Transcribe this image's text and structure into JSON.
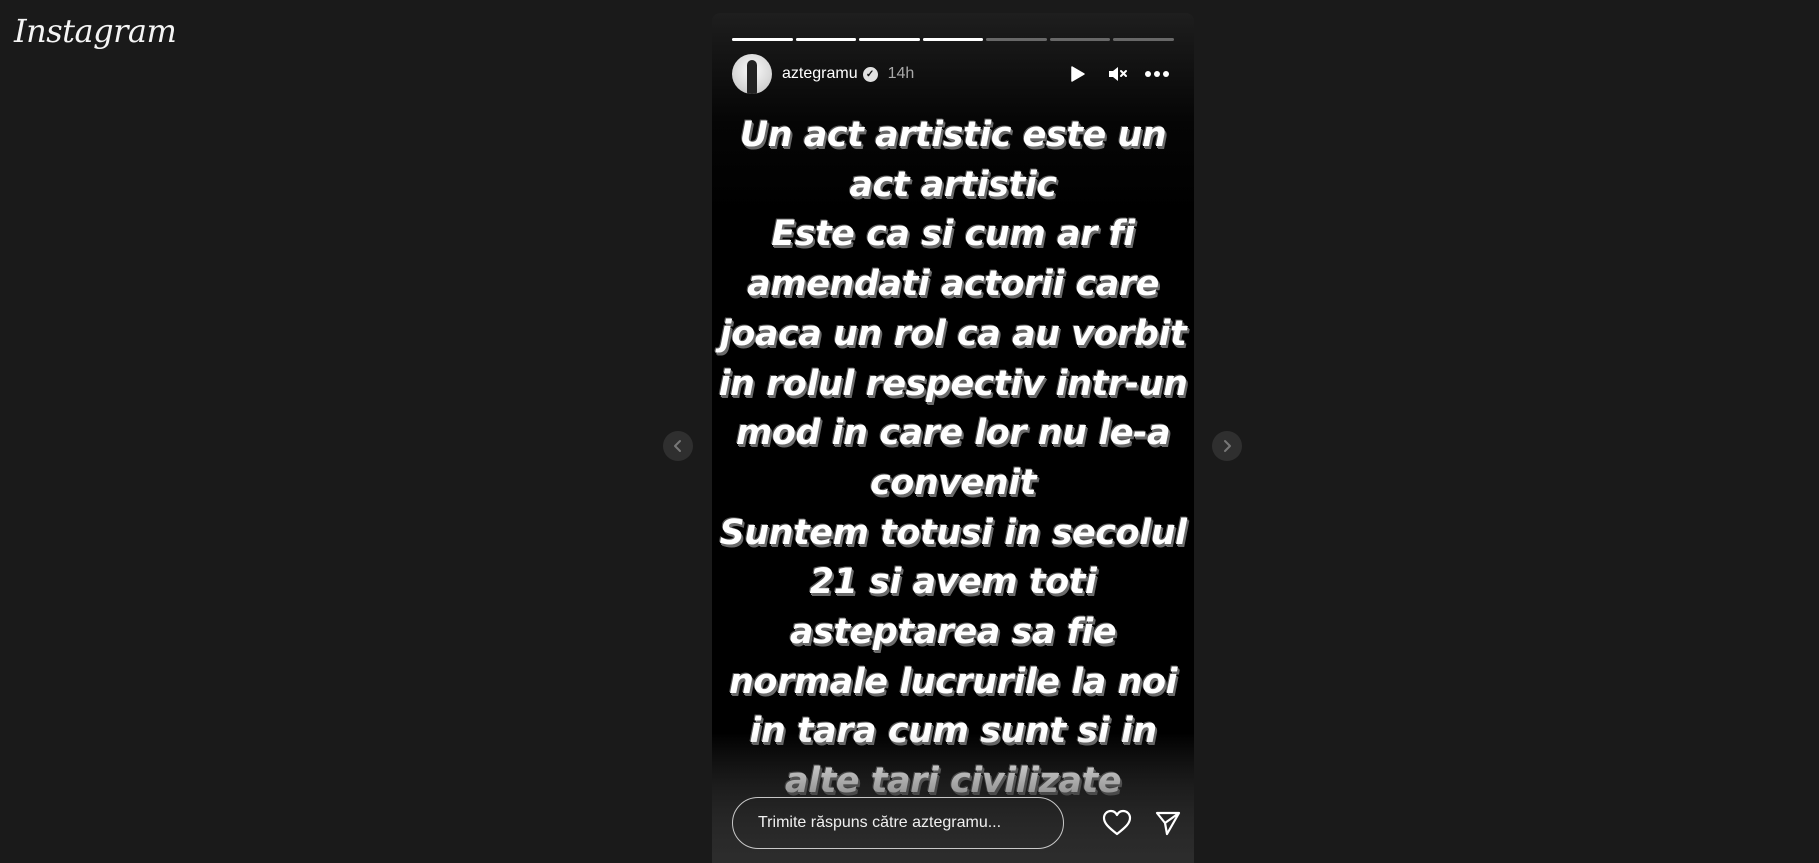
{
  "app": {
    "logo_text": "Instagram"
  },
  "story": {
    "progress": [
      1,
      1,
      1,
      1,
      0,
      0,
      0
    ],
    "user": {
      "username": "aztegramu",
      "verified": true,
      "time_ago": "14h"
    },
    "controls": {
      "play_icon": "play-icon",
      "mute_icon": "speaker-muted-icon",
      "more_icon": "more-horizontal-icon"
    },
    "text_lines": [
      "Un act artistic este un",
      "act artistic",
      "Este ca si cum ar fi",
      "amendati actorii care",
      "joaca un rol ca au vorbit",
      "in rolul respectiv intr-un",
      "mod in care lor nu le-a",
      "convenit",
      "Suntem totusi in secolul",
      "21 si avem toti",
      "asteptarea sa fie",
      "normale lucrurile la noi",
      "in tara cum sunt si in",
      "alte tari civilizate"
    ],
    "reply": {
      "placeholder": "Trimite răspuns către aztegramu..."
    },
    "footer": {
      "like_icon": "heart-icon",
      "share_icon": "send-icon"
    }
  },
  "navigation": {
    "prev_icon": "chevron-left-icon",
    "next_icon": "chevron-right-icon"
  }
}
